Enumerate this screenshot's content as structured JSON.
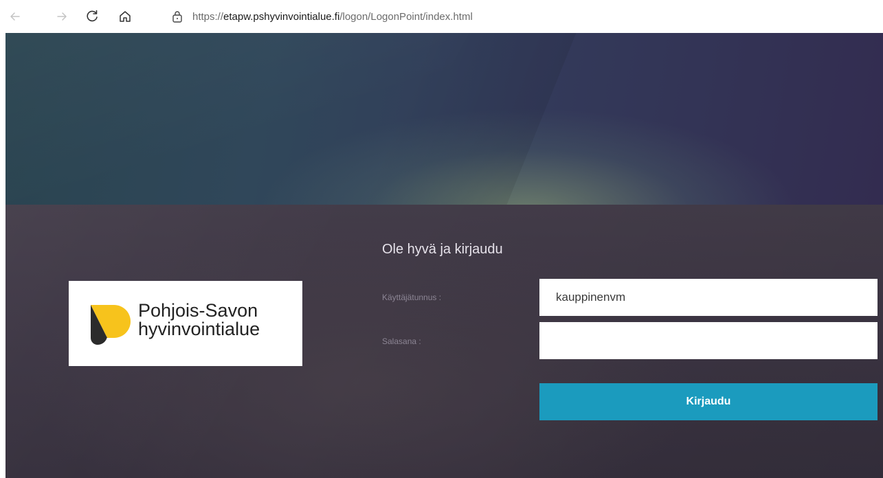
{
  "browser": {
    "url_scheme": "https://",
    "url_host": "etapw.pshyvinvointialue.fi",
    "url_path": "/logon/LogonPoint/index.html",
    "icons": [
      "back-icon",
      "forward-icon",
      "reload-icon",
      "home-icon",
      "lock-icon"
    ]
  },
  "logo": {
    "line1": "Pohjois-Savon",
    "line2": "hyvinvointialue",
    "colors": {
      "yellow": "#f7c31c",
      "dark": "#2b2b2b"
    }
  },
  "form": {
    "title": "Ole hyvä ja kirjaudu",
    "username_label": "Käyttäjätunnus :",
    "username_value": "kauppinenvm",
    "password_label": "Salasana :",
    "password_value": "",
    "submit_label": "Kirjaudu",
    "accent_color": "#1b9bbe"
  }
}
